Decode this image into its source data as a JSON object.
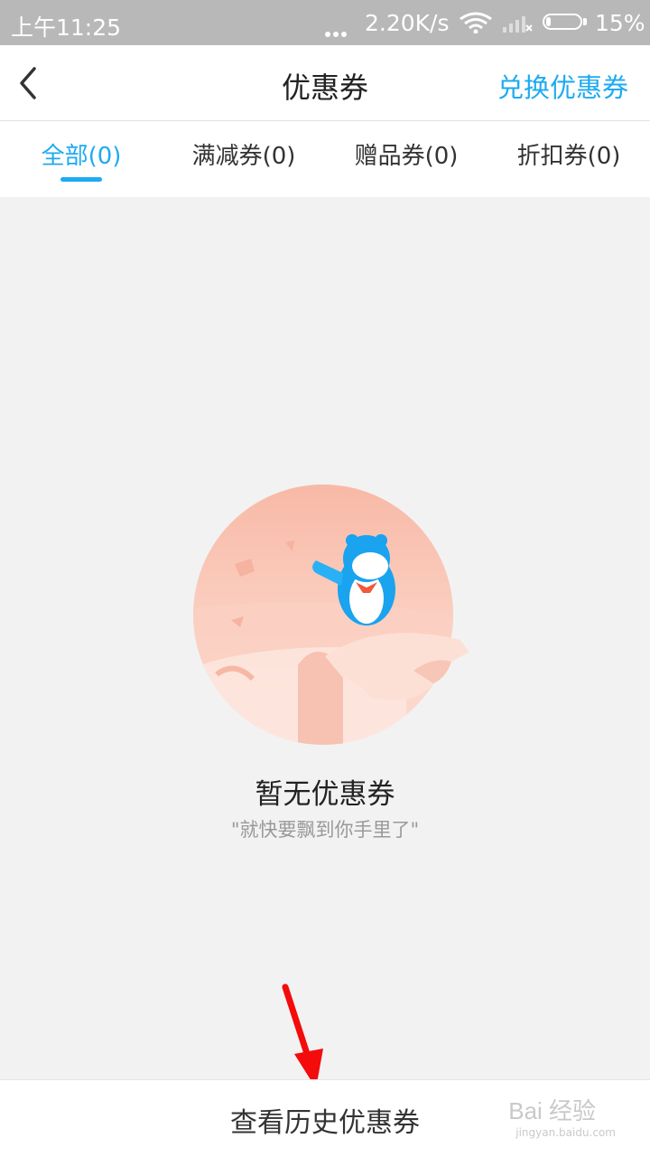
{
  "status_bar": {
    "time": "上午11:25",
    "speed": "2.20K/s",
    "battery_percent": "15%",
    "battery_level": 0.15
  },
  "nav": {
    "back_icon": "chevron-left-icon",
    "title": "优惠券",
    "action_label": "兑换优惠券",
    "accent_color": "#1eaaf1"
  },
  "tabs": [
    {
      "label": "全部(0)",
      "active": true
    },
    {
      "label": "满减券(0)",
      "active": false
    },
    {
      "label": "赠品券(0)",
      "active": false
    },
    {
      "label": "折扣券(0)",
      "active": false
    }
  ],
  "empty_state": {
    "illustration": "penguin-mascot-illustration",
    "title": "暂无优惠券",
    "subtitle": "\"就快要飘到你手里了\""
  },
  "bottom_bar": {
    "label": "查看历史优惠券"
  },
  "watermark": {
    "brand": "Bai 经验",
    "url": "jingyan.baidu.com"
  }
}
